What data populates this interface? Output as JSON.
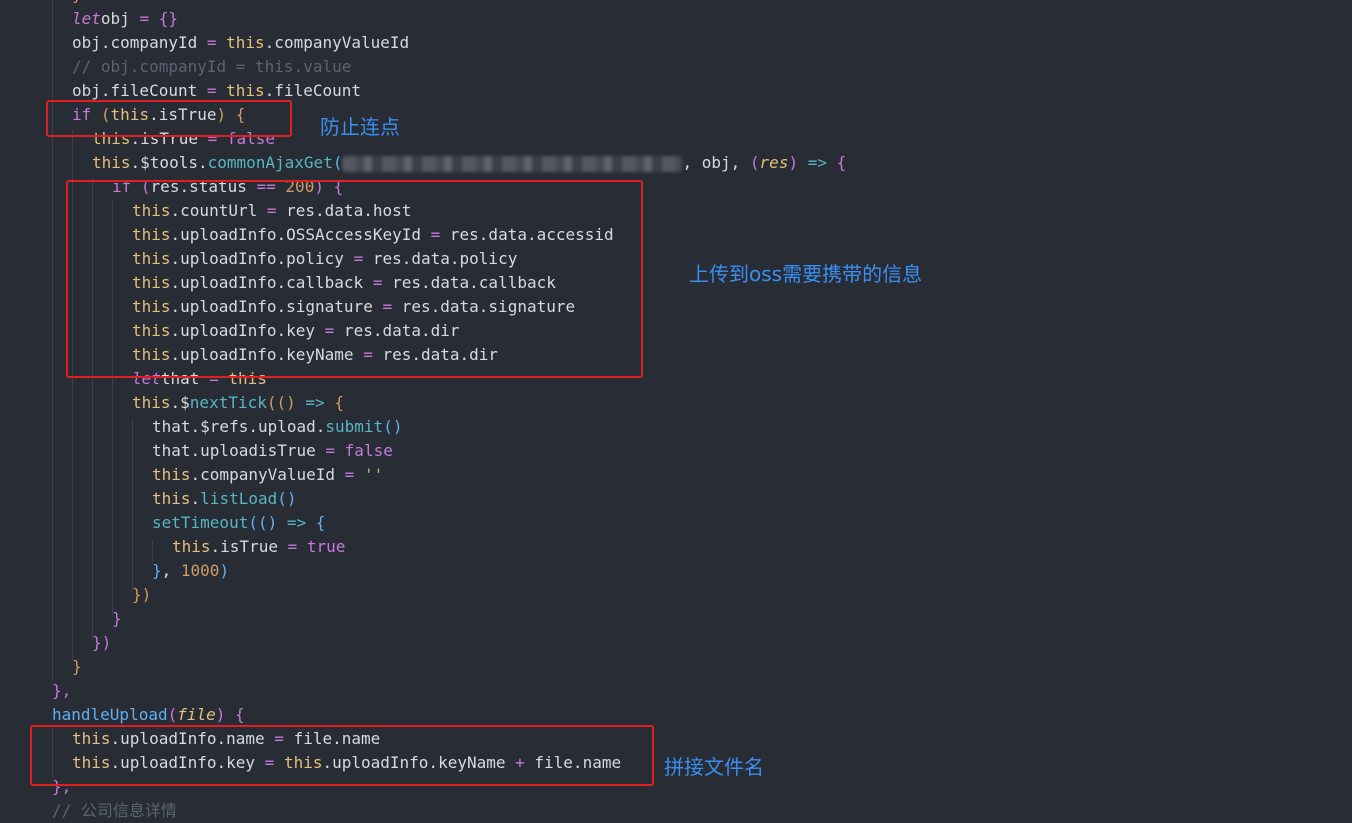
{
  "code_lines": [
    {
      "parts": [
        [
          "tok-br2",
          "}"
        ]
      ]
    },
    {
      "parts": [
        [
          "tok-kw",
          "let"
        ],
        [
          "",
          "obj "
        ],
        [
          "tok-op",
          "="
        ],
        [
          "",
          " "
        ],
        [
          "tok-br1",
          "{}"
        ]
      ]
    },
    {
      "parts": [
        [
          "",
          "obj.companyId "
        ],
        [
          "tok-op",
          "="
        ],
        [
          "",
          " "
        ],
        [
          "tok-this",
          "this"
        ],
        [
          "",
          ".companyValueId"
        ]
      ]
    },
    {
      "parts": [
        [
          "tok-cm",
          "// obj.companyId = this.value"
        ]
      ]
    },
    {
      "parts": [
        [
          "",
          "obj.fileCount "
        ],
        [
          "tok-op",
          "="
        ],
        [
          "",
          " "
        ],
        [
          "tok-this",
          "this"
        ],
        [
          "",
          ".fileCount"
        ]
      ]
    },
    {
      "parts": [
        [
          "tok-if",
          "if"
        ],
        [
          "",
          " "
        ],
        [
          "tok-br2",
          "("
        ],
        [
          "tok-this",
          "this"
        ],
        [
          "",
          ".isTrue"
        ],
        [
          "tok-br2",
          ")"
        ],
        [
          "",
          " "
        ],
        [
          "tok-br2",
          "{"
        ]
      ]
    },
    {
      "parts": [
        [
          "tok-this",
          "this"
        ],
        [
          "",
          ".isTrue "
        ],
        [
          "tok-op",
          "="
        ],
        [
          "",
          " "
        ],
        [
          "tok-bool",
          "false"
        ]
      ]
    },
    {
      "parts": [
        [
          "tok-this",
          "this"
        ],
        [
          "",
          ".$tools."
        ],
        [
          "tok-fn",
          "commonAjaxGet"
        ],
        [
          "tok-br3",
          "("
        ],
        [
          "blur",
          ""
        ],
        [
          "",
          ", obj, "
        ],
        [
          "tok-br4",
          "("
        ],
        [
          "tok-param",
          "res"
        ],
        [
          "tok-br4",
          ")"
        ],
        [
          "",
          " "
        ],
        [
          "tok-fn",
          "=>"
        ],
        [
          "",
          " "
        ],
        [
          "tok-br4",
          "{"
        ]
      ]
    },
    {
      "parts": [
        [
          "tok-if",
          "if"
        ],
        [
          "",
          " "
        ],
        [
          "tok-br1",
          "("
        ],
        [
          "",
          "res.status "
        ],
        [
          "tok-op",
          "=="
        ],
        [
          "",
          " "
        ],
        [
          "tok-num",
          "200"
        ],
        [
          "tok-br1",
          ")"
        ],
        [
          "",
          " "
        ],
        [
          "tok-br1",
          "{"
        ]
      ]
    },
    {
      "parts": [
        [
          "tok-this",
          "this"
        ],
        [
          "",
          ".countUrl "
        ],
        [
          "tok-op",
          "="
        ],
        [
          "",
          " res.data.host"
        ]
      ]
    },
    {
      "parts": [
        [
          "tok-this",
          "this"
        ],
        [
          "",
          ".uploadInfo.OSSAccessKeyId "
        ],
        [
          "tok-op",
          "="
        ],
        [
          "",
          " res.data.accessid"
        ]
      ]
    },
    {
      "parts": [
        [
          "tok-this",
          "this"
        ],
        [
          "",
          ".uploadInfo.policy "
        ],
        [
          "tok-op",
          "="
        ],
        [
          "",
          " res.data.policy"
        ]
      ]
    },
    {
      "parts": [
        [
          "tok-this",
          "this"
        ],
        [
          "",
          ".uploadInfo.callback "
        ],
        [
          "tok-op",
          "="
        ],
        [
          "",
          " res.data.callback"
        ]
      ]
    },
    {
      "parts": [
        [
          "tok-this",
          "this"
        ],
        [
          "",
          ".uploadInfo.signature "
        ],
        [
          "tok-op",
          "="
        ],
        [
          "",
          " res.data.signature"
        ]
      ]
    },
    {
      "parts": [
        [
          "tok-this",
          "this"
        ],
        [
          "",
          ".uploadInfo.key "
        ],
        [
          "tok-op",
          "="
        ],
        [
          "",
          " res.data.dir"
        ]
      ]
    },
    {
      "parts": [
        [
          "tok-this",
          "this"
        ],
        [
          "",
          ".uploadInfo.keyName "
        ],
        [
          "tok-op",
          "="
        ],
        [
          "",
          " res.data.dir"
        ]
      ]
    },
    {
      "parts": [
        [
          "tok-kw",
          "let"
        ],
        [
          "",
          "that "
        ],
        [
          "tok-op",
          "="
        ],
        [
          "",
          " "
        ],
        [
          "tok-this",
          "this"
        ]
      ]
    },
    {
      "parts": [
        [
          "tok-this",
          "this"
        ],
        [
          "",
          ".$"
        ],
        [
          "tok-fn",
          "nextTick"
        ],
        [
          "tok-br2",
          "(("
        ],
        [
          "tok-br2",
          ")"
        ],
        [
          "",
          " "
        ],
        [
          "tok-fn",
          "=>"
        ],
        [
          "",
          " "
        ],
        [
          "tok-br2",
          "{"
        ]
      ]
    },
    {
      "parts": [
        [
          "",
          "that.$refs.upload."
        ],
        [
          "tok-fn",
          "submit"
        ],
        [
          "tok-br3",
          "()"
        ]
      ]
    },
    {
      "parts": [
        [
          "",
          "that.uploadisTrue "
        ],
        [
          "tok-op",
          "="
        ],
        [
          "",
          " "
        ],
        [
          "tok-bool",
          "false"
        ]
      ]
    },
    {
      "parts": [
        [
          "tok-this",
          "this"
        ],
        [
          "",
          ".companyValueId "
        ],
        [
          "tok-op",
          "="
        ],
        [
          "",
          " "
        ],
        [
          "tok-str",
          "''"
        ]
      ]
    },
    {
      "parts": [
        [
          "tok-this",
          "this"
        ],
        [
          "",
          "."
        ],
        [
          "tok-fn",
          "listLoad"
        ],
        [
          "tok-br3",
          "()"
        ]
      ]
    },
    {
      "parts": [
        [
          "tok-fn",
          "setTimeout"
        ],
        [
          "tok-br3",
          "(("
        ],
        [
          "tok-br3",
          ")"
        ],
        [
          "",
          " "
        ],
        [
          "tok-fn",
          "=>"
        ],
        [
          "",
          " "
        ],
        [
          "tok-br3",
          "{"
        ]
      ]
    },
    {
      "parts": [
        [
          "tok-this",
          "this"
        ],
        [
          "",
          ".isTrue "
        ],
        [
          "tok-op",
          "="
        ],
        [
          "",
          " "
        ],
        [
          "tok-bool",
          "true"
        ]
      ]
    },
    {
      "parts": [
        [
          "tok-br3",
          "}"
        ],
        [
          "",
          ", "
        ],
        [
          "tok-num",
          "1000"
        ],
        [
          "tok-br3",
          ")"
        ]
      ]
    },
    {
      "parts": [
        [
          "tok-br2",
          "})"
        ]
      ]
    },
    {
      "parts": [
        [
          "tok-br1",
          "}"
        ]
      ]
    },
    {
      "parts": [
        [
          "tok-br4",
          "})"
        ]
      ]
    },
    {
      "parts": [
        [
          "tok-br2",
          "}"
        ]
      ]
    },
    {
      "parts": [
        [
          "tok-br1",
          "},"
        ]
      ]
    },
    {
      "parts": [
        [
          "tok-fnname",
          "handleUpload"
        ],
        [
          "tok-br1",
          "("
        ],
        [
          "tok-param",
          "file"
        ],
        [
          "tok-br1",
          ")"
        ],
        [
          "",
          " "
        ],
        [
          "tok-br1",
          "{"
        ]
      ]
    },
    {
      "parts": [
        [
          "tok-this",
          "this"
        ],
        [
          "",
          ".uploadInfo.name "
        ],
        [
          "tok-op",
          "="
        ],
        [
          "",
          " file.name"
        ]
      ]
    },
    {
      "parts": [
        [
          "tok-this",
          "this"
        ],
        [
          "",
          ".uploadInfo.key "
        ],
        [
          "tok-op",
          "="
        ],
        [
          "",
          " "
        ],
        [
          "tok-this",
          "this"
        ],
        [
          "",
          ".uploadInfo.keyName "
        ],
        [
          "tok-op",
          "+"
        ],
        [
          "",
          " file.name"
        ]
      ]
    },
    {
      "parts": [
        [
          "tok-br1",
          "},"
        ]
      ]
    },
    {
      "parts": [
        [
          "tok-cm",
          "// 公司信息详情"
        ]
      ]
    }
  ],
  "annotations": {
    "prevent_repeat": "防止连点",
    "oss_info": "上传到oss需要携带的信息",
    "concat_filename": "拼接文件名"
  }
}
